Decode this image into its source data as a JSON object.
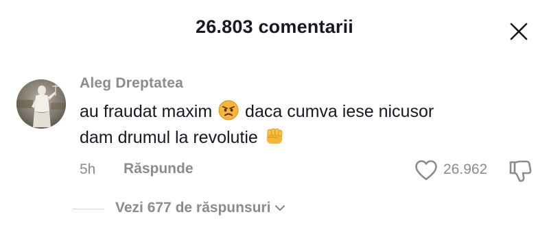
{
  "header": {
    "title": "26.803 comentarii"
  },
  "comment": {
    "username": "Aleg Dreptatea",
    "text_part1": "au fraudat maxim",
    "emoji1": "angry-face",
    "text_part2": "daca cumva iese nicusor",
    "text_part3": "dam drumul la revolutie",
    "emoji2": "oncoming-fist",
    "timestamp": "5h",
    "reply_label": "Răspunde",
    "like_count": "26.962",
    "view_replies_label": "Vezi 677 de răspunsuri"
  },
  "icons": {
    "close": "close-icon",
    "like": "heart-outline-icon",
    "dislike": "thumbs-down-icon",
    "expand": "chevron-down-icon"
  },
  "colors": {
    "primary_text": "#161823",
    "secondary_text": "#8a8b91",
    "background": "#ffffff"
  }
}
